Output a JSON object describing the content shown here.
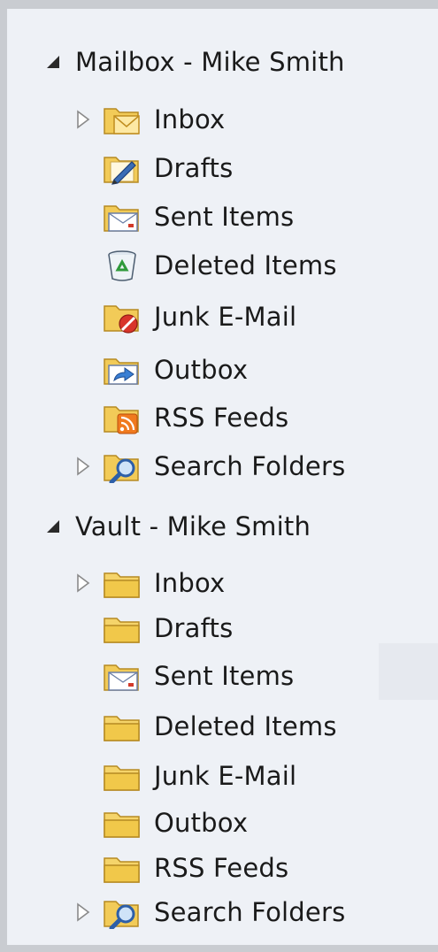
{
  "mailboxes": [
    {
      "label": "Mailbox - Mike Smith",
      "folders": [
        {
          "label": "Inbox",
          "icon": "inbox-envelope-folder-icon",
          "expandable": true
        },
        {
          "label": "Drafts",
          "icon": "drafts-pencil-folder-icon",
          "expandable": false
        },
        {
          "label": "Sent Items",
          "icon": "sent-items-folder-icon",
          "expandable": false
        },
        {
          "label": "Deleted Items",
          "icon": "recycle-bin-icon",
          "expandable": false
        },
        {
          "label": "Junk E-Mail",
          "icon": "junk-blocked-folder-icon",
          "expandable": false
        },
        {
          "label": "Outbox",
          "icon": "outbox-arrow-folder-icon",
          "expandable": false
        },
        {
          "label": "RSS Feeds",
          "icon": "rss-feeds-folder-icon",
          "expandable": false
        },
        {
          "label": "Search Folders",
          "icon": "search-folder-icon",
          "expandable": true
        }
      ]
    },
    {
      "label": "Vault - Mike Smith",
      "folders": [
        {
          "label": "Inbox",
          "icon": "folder-icon",
          "expandable": true
        },
        {
          "label": "Drafts",
          "icon": "folder-icon",
          "expandable": false
        },
        {
          "label": "Sent Items",
          "icon": "sent-items-folder-icon",
          "expandable": false
        },
        {
          "label": "Deleted Items",
          "icon": "folder-icon",
          "expandable": false
        },
        {
          "label": "Junk E-Mail",
          "icon": "folder-icon",
          "expandable": false
        },
        {
          "label": "Outbox",
          "icon": "folder-icon",
          "expandable": false
        },
        {
          "label": "RSS Feeds",
          "icon": "folder-icon",
          "expandable": false
        },
        {
          "label": "Search Folders",
          "icon": "search-folder-icon",
          "expandable": true
        }
      ]
    }
  ],
  "colors": {
    "pane_background": "#eef1f6",
    "pane_border": "#c9ccd1",
    "folder_yellow": "#f3cd52",
    "text": "#1a1a1a"
  }
}
